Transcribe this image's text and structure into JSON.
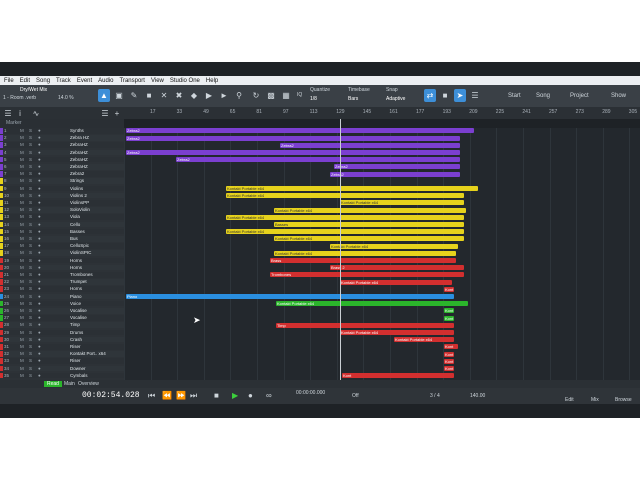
{
  "menu": [
    "File",
    "Edit",
    "Song",
    "Track",
    "Event",
    "Audio",
    "Transport",
    "View",
    "Studio One",
    "Help"
  ],
  "toolbar": {
    "preset_name": "Dry/Wet Mix",
    "preset_sub": "1 - Room .verb",
    "preset_pct": "14.0 %",
    "quantize_label": "Quantize",
    "quantize_value": "1/8",
    "timebase_label": "Timebase",
    "timebase_value": "Bars",
    "snap_label": "Snap",
    "snap_value": "Adaptive",
    "iq_label": "IQ",
    "start": "Start",
    "song": "Song",
    "project": "Project",
    "show": "Show"
  },
  "ruler": [
    "17",
    "33",
    "49",
    "65",
    "81",
    "97",
    "113",
    "129",
    "145",
    "161",
    "177",
    "193",
    "209",
    "225",
    "241",
    "257",
    "273",
    "289",
    "305",
    "321"
  ],
  "marker_label": "Marker",
  "tracks": [
    {
      "n": "1",
      "name": "Synths",
      "color": "#7b3fd0"
    },
    {
      "n": "2",
      "name": "Zebra HZ",
      "color": "#7b3fd0"
    },
    {
      "n": "3",
      "name": "ZebraHZ",
      "color": "#7b3fd0"
    },
    {
      "n": "4",
      "name": "ZebraHZ",
      "color": "#7b3fd0"
    },
    {
      "n": "5",
      "name": "ZebraHZ",
      "color": "#7b3fd0"
    },
    {
      "n": "6",
      "name": "ZebraHZ",
      "color": "#7b3fd0"
    },
    {
      "n": "7",
      "name": "Zebra2",
      "color": "#7b3fd0"
    },
    {
      "n": "8",
      "name": "Strings",
      "color": "#e6d21c"
    },
    {
      "n": "9",
      "name": "Violins",
      "color": "#e6d21c"
    },
    {
      "n": "10",
      "name": "Violins 2",
      "color": "#e6d21c"
    },
    {
      "n": "11",
      "name": "ViolinsPP",
      "color": "#e6d21c"
    },
    {
      "n": "12",
      "name": "SoloViolin",
      "color": "#e6d21c"
    },
    {
      "n": "13",
      "name": "Viola",
      "color": "#e6d21c"
    },
    {
      "n": "14",
      "name": "Cello",
      "color": "#e6d21c"
    },
    {
      "n": "15",
      "name": "Basses",
      "color": "#e6d21c"
    },
    {
      "n": "16",
      "name": "Bus",
      "color": "#e6d21c"
    },
    {
      "n": "17",
      "name": "CelloSpic",
      "color": "#e6d21c"
    },
    {
      "n": "18",
      "name": "ViolinSPIC",
      "color": "#e6d21c"
    },
    {
      "n": "19",
      "name": "Horns",
      "color": "#d22f2f"
    },
    {
      "n": "20",
      "name": "Horns",
      "color": "#d22f2f"
    },
    {
      "n": "21",
      "name": "Trombones",
      "color": "#d22f2f"
    },
    {
      "n": "22",
      "name": "Trumpet",
      "color": "#d22f2f"
    },
    {
      "n": "23",
      "name": "Horns",
      "color": "#d22f2f"
    },
    {
      "n": "24",
      "name": "Piano",
      "color": "#2a8fe0"
    },
    {
      "n": "25",
      "name": "Voice",
      "color": "#2bb52b"
    },
    {
      "n": "26",
      "name": "Vocalise",
      "color": "#2bb52b"
    },
    {
      "n": "27",
      "name": "Vocalise",
      "color": "#2bb52b"
    },
    {
      "n": "28",
      "name": "Timp",
      "color": "#d22f2f"
    },
    {
      "n": "29",
      "name": "Drums",
      "color": "#d22f2f"
    },
    {
      "n": "30",
      "name": "Crash",
      "color": "#d22f2f"
    },
    {
      "n": "31",
      "name": "Riser",
      "color": "#d22f2f"
    },
    {
      "n": "32",
      "name": "Kontakt Port.. x64",
      "color": "#d22f2f"
    },
    {
      "n": "33",
      "name": "Riser",
      "color": "#d22f2f"
    },
    {
      "n": "34",
      "name": "Downer",
      "color": "#d22f2f"
    },
    {
      "n": "35",
      "name": "Cymbals",
      "color": "#d22f2f"
    }
  ],
  "status": {
    "main": "Main",
    "overview": "Overview",
    "read": "Read"
  },
  "transport": {
    "time": "00:02:54.028",
    "off": "Off",
    "position": "00:00:00.000",
    "signature": "3 / 4",
    "tempo": "140.00",
    "edit": "Edit",
    "mix": "Mix",
    "browse": "Browse"
  },
  "clip_labels": {
    "zebra": "Zebra2",
    "kontakt": "Kontakt Portable x64",
    "brass": "Brass",
    "brass2": "Brass 2",
    "trombones": "Trombones",
    "piano": "Piano",
    "timp": "Timp",
    "basses": "Basses",
    "kont": "Kont"
  },
  "colors": {
    "synth": "#7b3fd0",
    "strings": "#e6d21c",
    "brass": "#d22f2f",
    "piano": "#2a8fe0",
    "voice": "#2bb52b",
    "accent": "#3d8fd8"
  }
}
